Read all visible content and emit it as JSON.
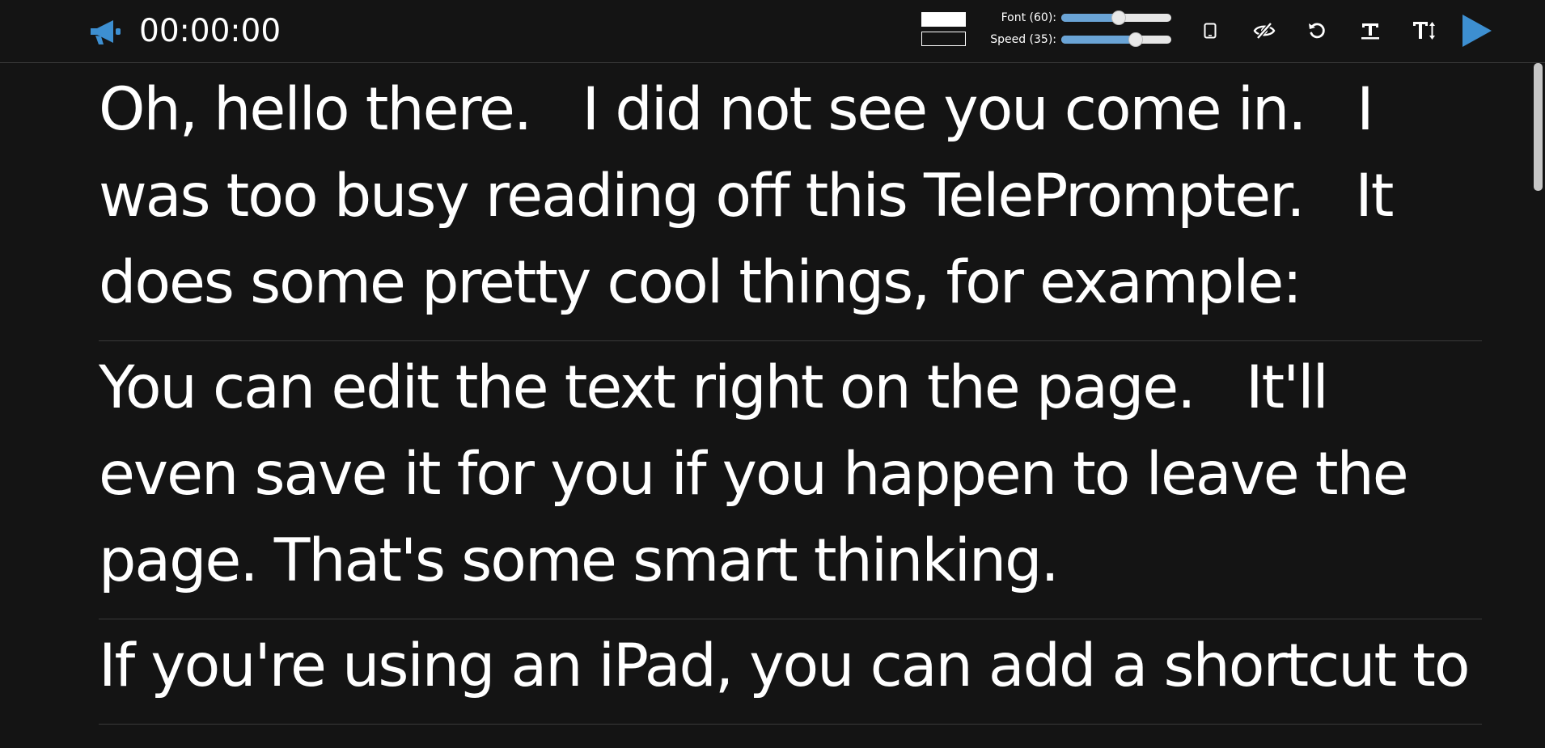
{
  "header": {
    "brand_icon": "megaphone-icon",
    "timer": "00:00:00",
    "colors": {
      "background_swatch": "#ffffff",
      "text_swatch": "#141414",
      "accent": "#3d8fd1"
    },
    "font_slider": {
      "label": "Font (60):",
      "value_fraction": 0.52
    },
    "speed_slider": {
      "label": "Speed (35):",
      "value_fraction": 0.68
    },
    "buttons": [
      {
        "name": "device-toggle",
        "icon": "tablet-icon"
      },
      {
        "name": "hide-toggle",
        "icon": "eye-slash-icon"
      },
      {
        "name": "reset",
        "icon": "undo-icon"
      },
      {
        "name": "text-style",
        "icon": "text-icon"
      },
      {
        "name": "text-size",
        "icon": "text-height-icon"
      },
      {
        "name": "play",
        "icon": "play-icon"
      }
    ]
  },
  "script": {
    "paragraphs": [
      "Oh, hello there.   I did not see you come in.   I was too busy reading off this TelePrompter.   It does some pretty cool things, for example:",
      "You can edit the text right on the page.   It'll even save it for you if you happen to leave the page. That's some smart thinking.",
      "If you're using an iPad, you can add a shortcut to"
    ]
  }
}
